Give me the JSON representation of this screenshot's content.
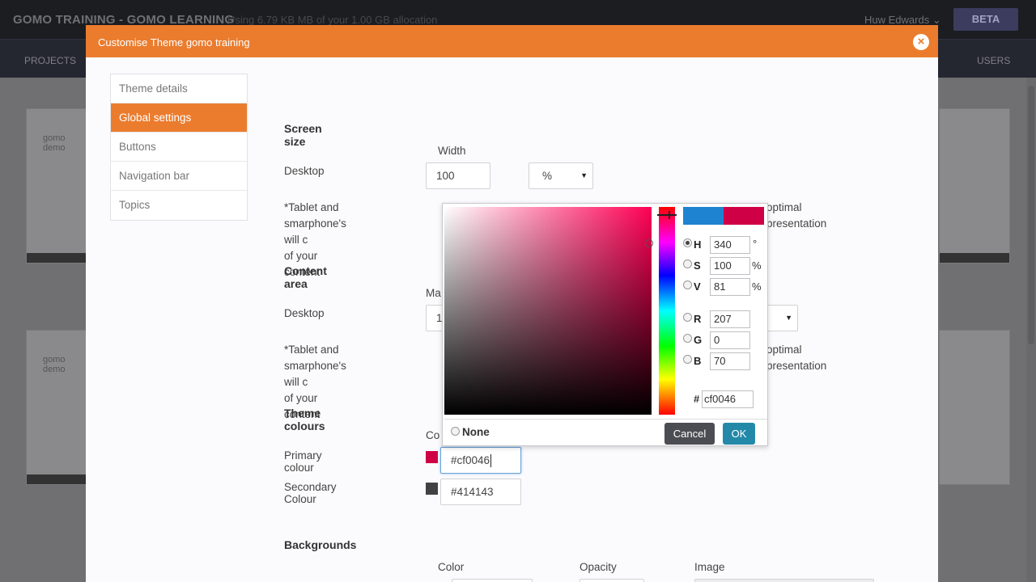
{
  "app": {
    "brand": "GOMO TRAINING - GOMO LEARNING",
    "usage": "Using 6.79 KB MB of your 1.00 GB allocation",
    "user": "Huw Edwards",
    "beta_label": "BETA",
    "nav_left": "PROJECTS",
    "nav_right": "USERS",
    "thumb_title": "gomo demo"
  },
  "modal": {
    "title": "Customise Theme gomo training",
    "close_icon": "close-icon",
    "sidebar": [
      {
        "label": "Theme details",
        "active": false
      },
      {
        "label": "Global settings",
        "active": true
      },
      {
        "label": "Buttons",
        "active": false
      },
      {
        "label": "Navigation bar",
        "active": false
      },
      {
        "label": "Topics",
        "active": false
      }
    ],
    "screen_size": {
      "heading": "Screen size",
      "width_label": "Width",
      "desktop_label": "Desktop",
      "width_value": "100",
      "unit_value": "%",
      "note_line1": "*Tablet and smarphone's will c",
      "note_tail": "optimal presentation",
      "note_line2": "of your content"
    },
    "content_area": {
      "heading": "Content area",
      "max_label": "Ma",
      "desktop_label": "Desktop",
      "value_partial": "1",
      "note_line1": "*Tablet and smarphone's will c",
      "note_tail": "optimal presentation",
      "note_line2": "of your content"
    },
    "theme_colours": {
      "heading": "Theme colours",
      "col_label": "Co",
      "primary_label": "Primary colour",
      "primary_value": "#cf0046",
      "primary_color": "#cf0046",
      "secondary_label": "Secondary Colour",
      "secondary_value": "#414143",
      "secondary_color": "#414143"
    },
    "backgrounds": {
      "heading": "Backgrounds",
      "color_label": "Color",
      "opacity_label": "Opacity",
      "image_label": "Image"
    }
  },
  "color_picker": {
    "new_color": "#1e83d1",
    "current_color": "#cf0046",
    "h": "340",
    "h_unit": "°",
    "s": "100",
    "s_unit": "%",
    "v": "81",
    "v_unit": "%",
    "r": "207",
    "g": "0",
    "b": "70",
    "hex_prefix": "#",
    "hex": "cf0046",
    "labels": {
      "h": "H",
      "s": "S",
      "v": "V",
      "r": "R",
      "g": "G",
      "b": "B"
    },
    "none_label": "None",
    "cancel_label": "Cancel",
    "ok_label": "OK"
  }
}
